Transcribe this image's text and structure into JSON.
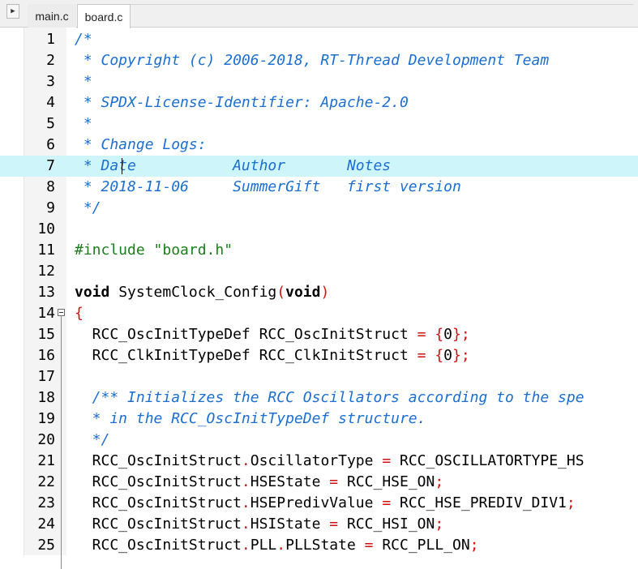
{
  "tabs": [
    {
      "label": "main.c",
      "active": false
    },
    {
      "label": "board.c",
      "active": true
    }
  ],
  "nav_icon": "triangle-right-icon",
  "colors": {
    "comment": "#1c6fd0",
    "preprocessor": "#1a7f1a",
    "operator": "#d01010",
    "highlight": "#cef6fa"
  },
  "current_line": 7,
  "lines": [
    {
      "n": "1",
      "tokens": [
        {
          "t": "/*",
          "c": "cm"
        }
      ]
    },
    {
      "n": "2",
      "tokens": [
        {
          "t": " * Copyright (c) 2006-2018, RT-Thread Development Team",
          "c": "cm"
        }
      ]
    },
    {
      "n": "3",
      "tokens": [
        {
          "t": " *",
          "c": "cm"
        }
      ]
    },
    {
      "n": "4",
      "tokens": [
        {
          "t": " * SPDX-License-Identifier: Apache-2.0",
          "c": "cm"
        }
      ]
    },
    {
      "n": "5",
      "tokens": [
        {
          "t": " *",
          "c": "cm"
        }
      ]
    },
    {
      "n": "6",
      "tokens": [
        {
          "t": " * Change Logs:",
          "c": "cm"
        }
      ]
    },
    {
      "n": "7",
      "tokens": [
        {
          "t": " * Date           Author       Notes",
          "c": "cm"
        }
      ]
    },
    {
      "n": "8",
      "tokens": [
        {
          "t": " * 2018-11-06     SummerGift   first version",
          "c": "cm"
        }
      ]
    },
    {
      "n": "9",
      "tokens": [
        {
          "t": " */",
          "c": "cm"
        }
      ]
    },
    {
      "n": "10",
      "tokens": []
    },
    {
      "n": "11",
      "tokens": [
        {
          "t": "#include \"board.h\"",
          "c": "pp"
        }
      ]
    },
    {
      "n": "12",
      "tokens": []
    },
    {
      "n": "13",
      "tokens": [
        {
          "t": "void",
          "c": "kw"
        },
        {
          "t": " SystemClock_Config",
          "c": ""
        },
        {
          "t": "(",
          "c": "op"
        },
        {
          "t": "void",
          "c": "kw"
        },
        {
          "t": ")",
          "c": "op"
        }
      ]
    },
    {
      "n": "14",
      "fold": true,
      "tokens": [
        {
          "t": "{",
          "c": "op"
        }
      ]
    },
    {
      "n": "15",
      "tokens": [
        {
          "t": "  RCC_OscInitTypeDef RCC_OscInitStruct ",
          "c": ""
        },
        {
          "t": "=",
          "c": "op"
        },
        {
          "t": " ",
          "c": ""
        },
        {
          "t": "{",
          "c": "op"
        },
        {
          "t": "0",
          "c": ""
        },
        {
          "t": "};",
          "c": "op"
        }
      ]
    },
    {
      "n": "16",
      "tokens": [
        {
          "t": "  RCC_ClkInitTypeDef RCC_ClkInitStruct ",
          "c": ""
        },
        {
          "t": "=",
          "c": "op"
        },
        {
          "t": " ",
          "c": ""
        },
        {
          "t": "{",
          "c": "op"
        },
        {
          "t": "0",
          "c": ""
        },
        {
          "t": "};",
          "c": "op"
        }
      ]
    },
    {
      "n": "17",
      "tokens": []
    },
    {
      "n": "18",
      "tokens": [
        {
          "t": "  /** Initializes the RCC Oscillators according to the spe",
          "c": "cm"
        }
      ]
    },
    {
      "n": "19",
      "tokens": [
        {
          "t": "  * in the RCC_OscInitTypeDef structure.",
          "c": "cm"
        }
      ]
    },
    {
      "n": "20",
      "tokens": [
        {
          "t": "  */",
          "c": "cm"
        }
      ]
    },
    {
      "n": "21",
      "tokens": [
        {
          "t": "  RCC_OscInitStruct",
          "c": ""
        },
        {
          "t": ".",
          "c": "op"
        },
        {
          "t": "OscillatorType ",
          "c": ""
        },
        {
          "t": "=",
          "c": "op"
        },
        {
          "t": " RCC_OSCILLATORTYPE_HS",
          "c": ""
        }
      ]
    },
    {
      "n": "22",
      "tokens": [
        {
          "t": "  RCC_OscInitStruct",
          "c": ""
        },
        {
          "t": ".",
          "c": "op"
        },
        {
          "t": "HSEState ",
          "c": ""
        },
        {
          "t": "=",
          "c": "op"
        },
        {
          "t": " RCC_HSE_ON",
          "c": ""
        },
        {
          "t": ";",
          "c": "op"
        }
      ]
    },
    {
      "n": "23",
      "tokens": [
        {
          "t": "  RCC_OscInitStruct",
          "c": ""
        },
        {
          "t": ".",
          "c": "op"
        },
        {
          "t": "HSEPredivValue ",
          "c": ""
        },
        {
          "t": "=",
          "c": "op"
        },
        {
          "t": " RCC_HSE_PREDIV_DIV1",
          "c": ""
        },
        {
          "t": ";",
          "c": "op"
        }
      ]
    },
    {
      "n": "24",
      "tokens": [
        {
          "t": "  RCC_OscInitStruct",
          "c": ""
        },
        {
          "t": ".",
          "c": "op"
        },
        {
          "t": "HSIState ",
          "c": ""
        },
        {
          "t": "=",
          "c": "op"
        },
        {
          "t": " RCC_HSI_ON",
          "c": ""
        },
        {
          "t": ";",
          "c": "op"
        }
      ]
    },
    {
      "n": "25",
      "tokens": [
        {
          "t": "  RCC_OscInitStruct",
          "c": ""
        },
        {
          "t": ".",
          "c": "op"
        },
        {
          "t": "PLL",
          "c": ""
        },
        {
          "t": ".",
          "c": "op"
        },
        {
          "t": "PLLState ",
          "c": ""
        },
        {
          "t": "=",
          "c": "op"
        },
        {
          "t": " RCC_PLL_ON",
          "c": ""
        },
        {
          "t": ";",
          "c": "op"
        }
      ]
    }
  ]
}
